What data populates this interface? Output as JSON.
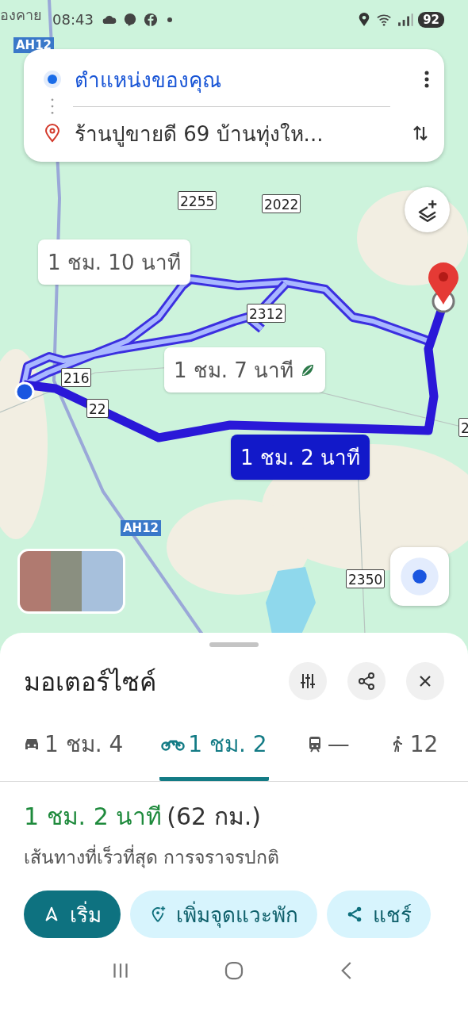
{
  "status_bar": {
    "time": "08:43",
    "battery": "92"
  },
  "map": {
    "place_label": "องคาย",
    "highway_badges": [
      {
        "label": "AH12"
      },
      {
        "label": "AH12"
      }
    ],
    "road_shields": [
      {
        "label": "2255"
      },
      {
        "label": "2022"
      },
      {
        "label": "2312"
      },
      {
        "label": "216"
      },
      {
        "label": "22"
      },
      {
        "label": "2350"
      },
      {
        "label": "2"
      }
    ],
    "routes": [
      {
        "label": "1 ชม. 10 นาที",
        "selected": false,
        "eco": false
      },
      {
        "label": "1 ชม. 7 นาที",
        "selected": false,
        "eco": true
      },
      {
        "label": "1 ชม. 2 นาที",
        "selected": true,
        "eco": false
      }
    ]
  },
  "search": {
    "origin": "ตำแหน่งของคุณ",
    "destination": "ร้านปูขายดี 69 บ้านทุ่งให..."
  },
  "sheet": {
    "title": "มอเตอร์ไซค์",
    "modes": [
      {
        "kind": "car",
        "label": "1 ชม. 4",
        "selected": false
      },
      {
        "kind": "motorbike",
        "label": "1 ชม. 2",
        "selected": true
      },
      {
        "kind": "train",
        "label": "—",
        "selected": false
      },
      {
        "kind": "walk",
        "label": "12",
        "selected": false
      }
    ],
    "duration": "1 ชม. 2 นาที",
    "distance": "(62 กม.)",
    "subtitle": "เส้นทางที่เร็วที่สุด การจราจรปกติ",
    "actions": [
      {
        "kind": "start",
        "label": "เริ่ม"
      },
      {
        "kind": "add_stop",
        "label": "เพิ่มจุดแวะพัก"
      },
      {
        "kind": "share",
        "label": "แชร์"
      }
    ]
  }
}
